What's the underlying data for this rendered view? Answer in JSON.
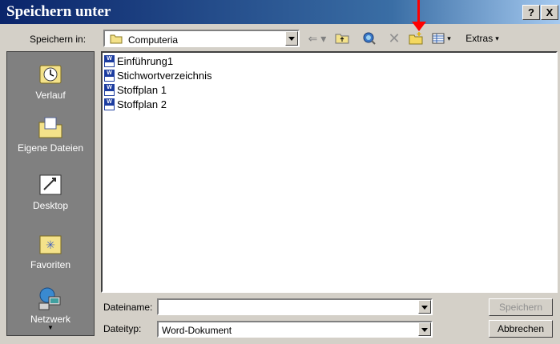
{
  "window": {
    "title": "Speichern unter",
    "help_label": "?",
    "close_label": "X"
  },
  "toolbar": {
    "save_in_label": "Speichern in:",
    "folder": "Computeria",
    "extras_label": "Extras",
    "back_icon": "back-arrow-icon",
    "up_icon": "up-folder-icon",
    "search_web_icon": "search-web-icon",
    "delete_icon": "delete-icon",
    "new_folder_icon": "new-folder-icon",
    "views_icon": "views-icon"
  },
  "places": [
    {
      "label": "Verlauf",
      "icon": "history-icon"
    },
    {
      "label": "Eigene Dateien",
      "icon": "my-documents-icon"
    },
    {
      "label": "Desktop",
      "icon": "desktop-icon"
    },
    {
      "label": "Favoriten",
      "icon": "favorites-icon"
    },
    {
      "label": "Netzwerk",
      "icon": "network-icon"
    }
  ],
  "files": [
    {
      "name": "Einführung1",
      "icon": "word-document-icon"
    },
    {
      "name": "Stichwortverzeichnis",
      "icon": "word-document-icon"
    },
    {
      "name": "Stoffplan 1",
      "icon": "word-document-icon"
    },
    {
      "name": "Stoffplan 2",
      "icon": "word-document-icon"
    }
  ],
  "form": {
    "filename_label": "Dateiname:",
    "filename_value": "",
    "filetype_label": "Dateityp:",
    "filetype_value": "Word-Dokument"
  },
  "buttons": {
    "save_label": "Speichern",
    "cancel_label": "Abbrechen"
  },
  "colors": {
    "title_bar": "#0a246a",
    "dialog_bg": "#d4d0c8",
    "places_bg": "#808080",
    "annotation_arrow": "#ff0000"
  }
}
